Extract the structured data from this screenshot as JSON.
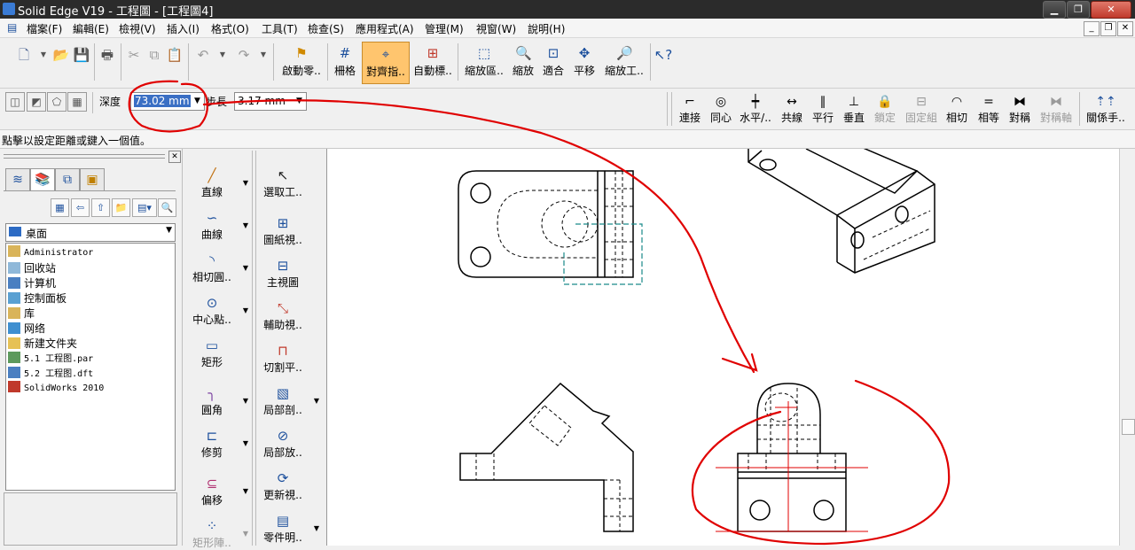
{
  "window": {
    "title": "Solid Edge V19 - 工程圖 - [工程圖4]"
  },
  "menubar": {
    "items": [
      "檔案(F)",
      "編輯(E)",
      "檢視(V)",
      "插入(I)",
      "格式(O)",
      "工具(T)",
      "檢查(S)",
      "應用程式(A)",
      "管理(M)",
      "視窗(W)",
      "說明(H)"
    ]
  },
  "toolbar1": {
    "start_part": "啟動零..",
    "grid": "柵格",
    "align_indicator": "對齊指..",
    "auto_label": "自動標..",
    "zoom_area": "縮放區..",
    "zoom": "縮放",
    "fit": "適合",
    "pan": "平移",
    "zoom_tool": "縮放工.."
  },
  "toolbar2": {
    "depth_label": "深度",
    "depth_value": "73.02 mm",
    "step_label": "步長",
    "step_value": "3.17 mm",
    "relations": [
      "連接",
      "同心",
      "水平/..",
      "共線",
      "平行",
      "垂直",
      "鎖定",
      "固定組",
      "相切",
      "相等",
      "對稱",
      "對稱軸",
      "關係手.."
    ]
  },
  "status": {
    "message": "點擊以設定距離或鍵入一個值。"
  },
  "left_panel": {
    "location": "桌面",
    "files": [
      "Administrator",
      "回收站",
      "计算机",
      "控制面板",
      "库",
      "网络",
      "新建文件夹",
      "5.1 工程图.par",
      "5.2 工程图.dft",
      "SolidWorks 2010"
    ]
  },
  "commands_col1": [
    "直線",
    "曲線",
    "相切圓..",
    "中心點..",
    "矩形",
    "圓角",
    "修剪",
    "偏移",
    "矩形陣.."
  ],
  "commands_col2": [
    "選取工..",
    "圖紙視..",
    "主視圖",
    "輔助視..",
    "切割平..",
    "局部剖..",
    "局部放..",
    "更新視..",
    "零件明.."
  ],
  "colors": {
    "annotation": "#e00000",
    "active_button": "#ffc56e",
    "highlight": "#1a8a8a"
  }
}
